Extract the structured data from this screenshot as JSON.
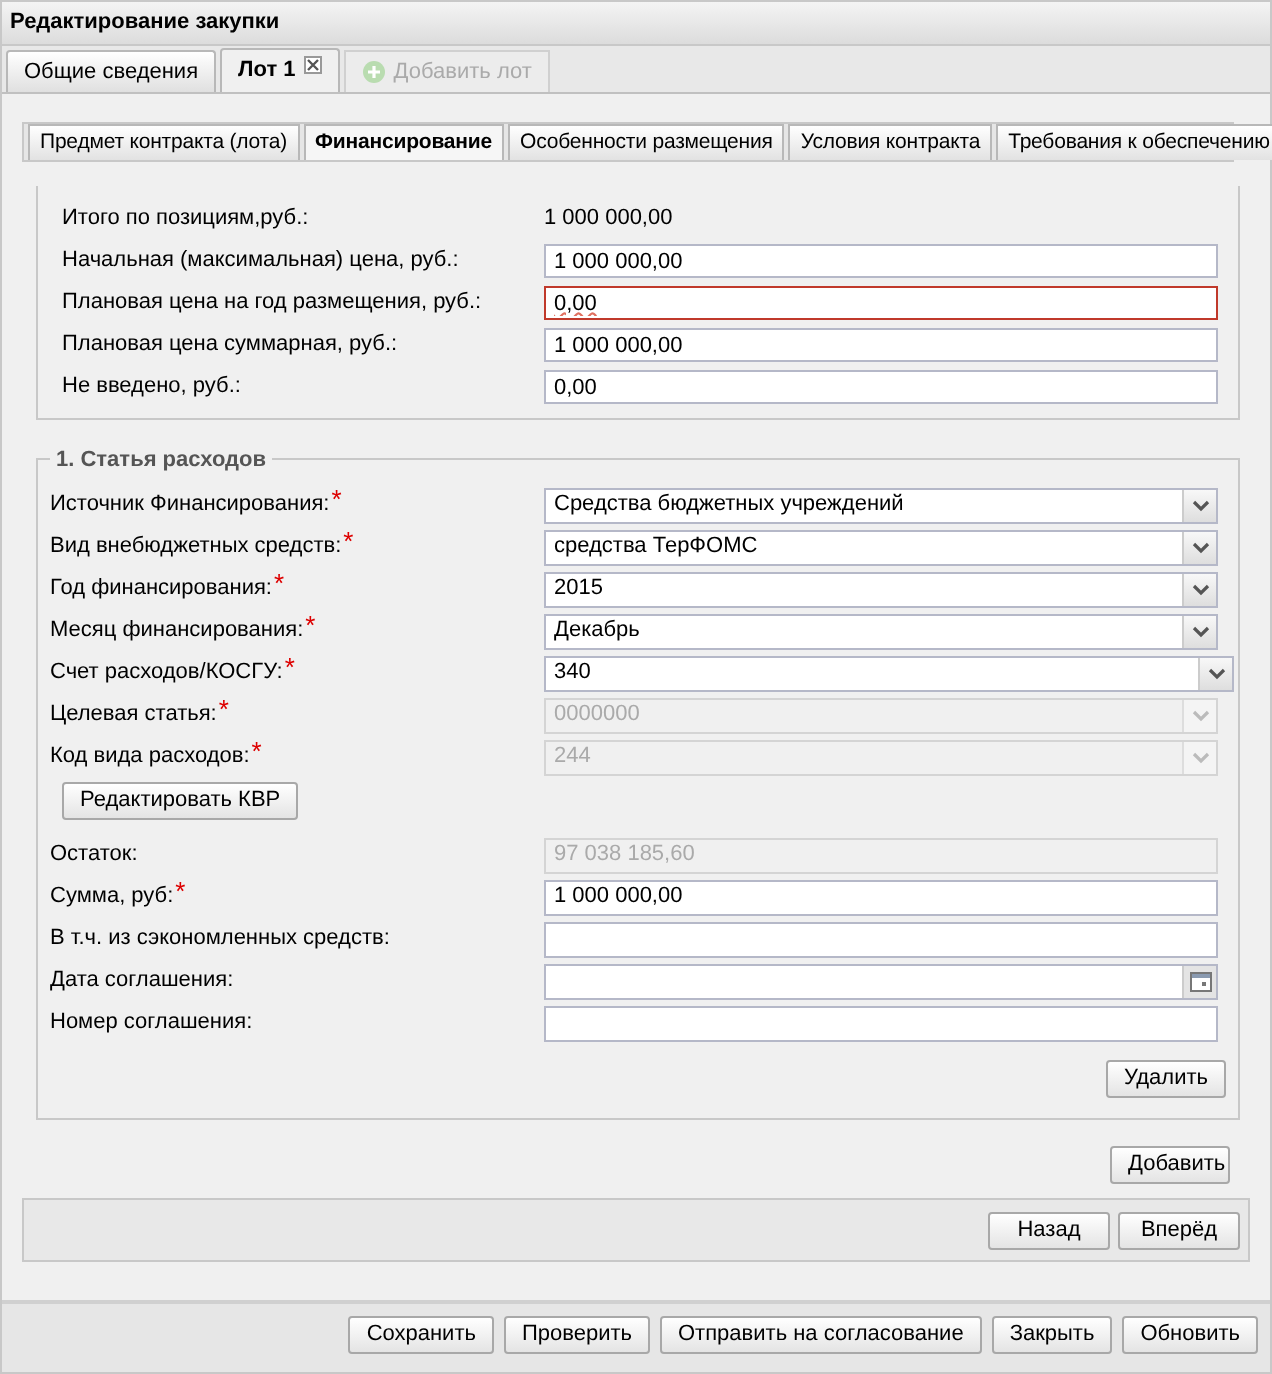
{
  "window": {
    "title": "Редактирование закупки"
  },
  "tabs": [
    {
      "label": "Общие сведения",
      "selected": false,
      "closable": false
    },
    {
      "label": "Лот 1",
      "selected": true,
      "closable": true
    }
  ],
  "add_lot": {
    "label": "Добавить лот",
    "disabled": true
  },
  "subtabs": [
    {
      "label": "Предмет контракта (лота)",
      "selected": false
    },
    {
      "label": "Финансирование",
      "selected": true
    },
    {
      "label": "Особенности размещения",
      "selected": false
    },
    {
      "label": "Условия контракта",
      "selected": false
    },
    {
      "label": "Требования к обеспечению",
      "selected": false
    }
  ],
  "totals": [
    {
      "kind": "static",
      "label": "Итого по позициям,руб.:",
      "value": "1 000 000,00"
    },
    {
      "kind": "text",
      "label": "Начальная (максимальная) цена, руб.:",
      "value": "1 000 000,00",
      "invalid": false
    },
    {
      "kind": "text",
      "label": "Плановая цена на год размещения, руб.:",
      "value": "0,00",
      "invalid": true
    },
    {
      "kind": "text",
      "label": "Плановая цена суммарная, руб.:",
      "value": "1 000 000,00",
      "invalid": false
    },
    {
      "kind": "text",
      "label": "Не введено, руб.:",
      "value": "0,00",
      "invalid": false
    }
  ],
  "expense": {
    "legend": "1. Статья расходов",
    "fields": [
      {
        "kind": "select",
        "label": "Источник Финансирования:",
        "required": true,
        "disabled": false,
        "value": "Средства бюджетных учреждений"
      },
      {
        "kind": "select",
        "label": "Вид внебюджетных средств:",
        "required": true,
        "disabled": false,
        "value": "средства ТерФОМС"
      },
      {
        "kind": "select",
        "label": "Год финансирования:",
        "required": true,
        "disabled": false,
        "value": "2015"
      },
      {
        "kind": "select",
        "label": "Месяц финансирования:",
        "required": true,
        "disabled": false,
        "value": "Декабрь"
      },
      {
        "kind": "select",
        "label": "Счет расходов/КОСГУ:",
        "required": true,
        "disabled": false,
        "value": "340"
      },
      {
        "kind": "select",
        "label": "Целевая статья:",
        "required": true,
        "disabled": true,
        "value": "0000000"
      },
      {
        "kind": "select",
        "label": "Код вида расходов:",
        "required": true,
        "disabled": true,
        "value": "244"
      }
    ],
    "edit_button": "Редактировать КВР",
    "fields2": [
      {
        "kind": "text",
        "label": "Остаток:",
        "required": false,
        "disabled": true,
        "value": "97 038 185,60"
      },
      {
        "kind": "text",
        "label": "Сумма, руб:",
        "required": true,
        "disabled": false,
        "value": "1 000 000,00"
      },
      {
        "kind": "text",
        "label": "В т.ч. из сэкономленных средств:",
        "required": false,
        "disabled": false
      },
      {
        "kind": "date",
        "label": "Дата соглашения:",
        "required": false,
        "disabled": false
      },
      {
        "kind": "text",
        "label": "Номер соглашения:",
        "required": false,
        "disabled": false
      }
    ],
    "required_mark": "*",
    "delete_button": "Удалить"
  },
  "add_button": "Добавить",
  "nav_buttons": [
    "Назад",
    "Вперёд"
  ],
  "footer_buttons": [
    "Сохранить",
    "Проверить",
    "Отправить на согласование",
    "Закрыть",
    "Обновить"
  ]
}
